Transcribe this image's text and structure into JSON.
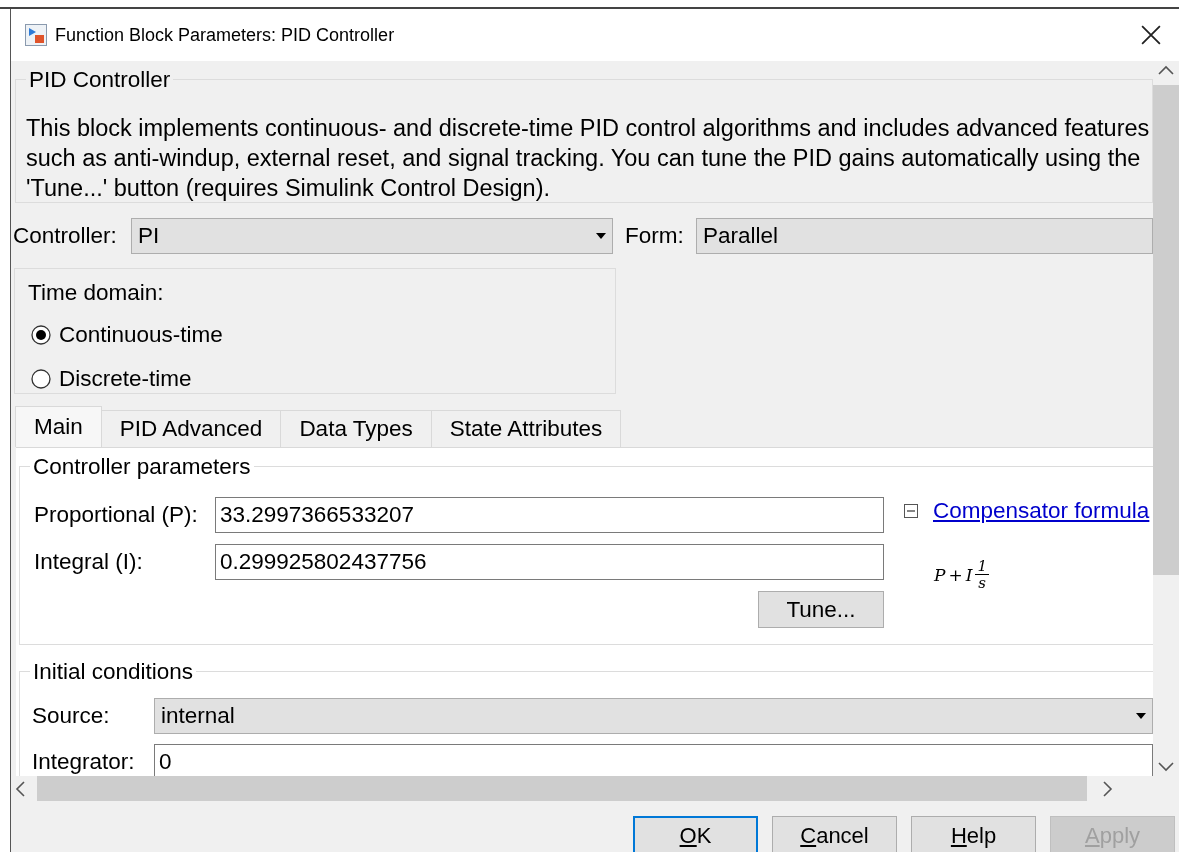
{
  "window": {
    "title": "Function Block Parameters: PID Controller"
  },
  "block": {
    "title": "PID Controller",
    "description": "This block implements continuous- and discrete-time PID control algorithms and includes advanced features such as anti-windup, external reset, and signal tracking. You can tune the PID gains automatically using the 'Tune...' button (requires Simulink Control Design)."
  },
  "controller": {
    "label": "Controller:",
    "value": "PI"
  },
  "form": {
    "label": "Form:",
    "value": "Parallel"
  },
  "time_domain": {
    "label": "Time domain:",
    "options": [
      {
        "label": "Continuous-time",
        "selected": true
      },
      {
        "label": "Discrete-time",
        "selected": false
      }
    ]
  },
  "tabs": [
    {
      "label": "Main",
      "selected": true
    },
    {
      "label": "PID Advanced",
      "selected": false
    },
    {
      "label": "Data Types",
      "selected": false
    },
    {
      "label": "State Attributes",
      "selected": false
    }
  ],
  "controller_parameters": {
    "title": "Controller parameters",
    "fields": [
      {
        "label": "Proportional (P):",
        "value": "33.2997366533207"
      },
      {
        "label": "Integral (I):",
        "value": "0.299925802437756"
      }
    ],
    "tune_button": "Tune...",
    "compensator": {
      "label": "Compensator formula",
      "expanded": true,
      "formula": {
        "terms": [
          "P",
          "+",
          "I"
        ],
        "numerator": "1",
        "denominator": "s"
      }
    }
  },
  "initial_conditions": {
    "title": "Initial conditions",
    "source": {
      "label": "Source:",
      "value": "internal"
    },
    "integrator": {
      "label": "Integrator:",
      "value": "0"
    }
  },
  "buttons": [
    {
      "label": "OK",
      "focused": true,
      "disabled": false,
      "mnemonic_underlined": true
    },
    {
      "label": "Cancel",
      "focused": false,
      "disabled": false,
      "mnemonic_underlined": true
    },
    {
      "label": "Help",
      "focused": false,
      "disabled": false,
      "mnemonic_underlined": true
    },
    {
      "label": "Apply",
      "focused": false,
      "disabled": true,
      "mnemonic_underlined": true
    }
  ]
}
